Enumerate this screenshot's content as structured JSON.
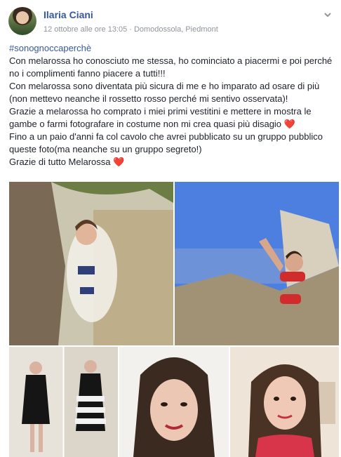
{
  "post": {
    "author": "Ilaria Ciani",
    "timestamp": "12 ottobre alle ore 13:05",
    "location": "Domodossola, Piedmont",
    "hashtag": "#sonognoccaperchè",
    "lines": [
      "Con melarossa ho conosciuto me stessa, ho cominciato a piacermi e poi perché no i complimenti fanno piacere a tutti!!!",
      "Con melarossa sono diventata più sicura di me e ho imparato ad osare di più (non mettevo neanche il rossetto rosso perché mi sentivo osservata)!",
      "Grazie a melarossa ho comprato i miei primi vestitini e mettere in mostra le gambe o farmi fotografare in costume non mi crea quasi più disagio",
      "Fino a un paio d'anni fa col cavolo che avrei pubblicato su un gruppo pubblico queste foto(ma neanche su un gruppo segreto!)",
      "Grazie di tutto Melarossa"
    ],
    "heart_glyph": "❤️"
  },
  "colors": {
    "link": "#365899",
    "meta": "#90949c",
    "heart": "#e85a79"
  },
  "icons": {
    "options": "chevron-down-icon",
    "globe": "globe-icon"
  }
}
